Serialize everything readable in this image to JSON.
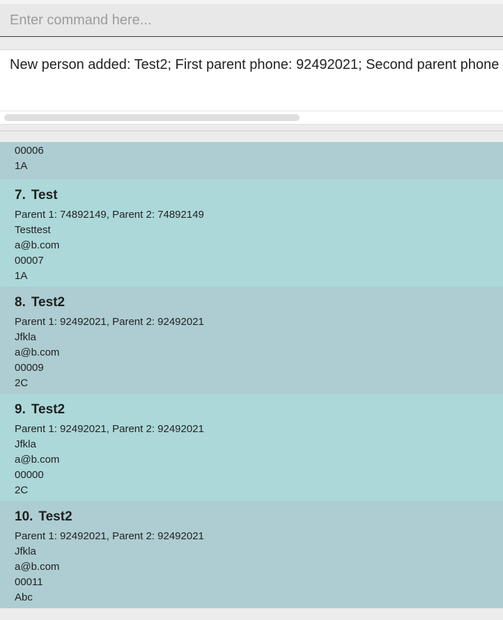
{
  "command": {
    "placeholder": "Enter command here..."
  },
  "result": {
    "text": "New person added: Test2; First parent phone: 92492021; Second parent phone"
  },
  "list": {
    "partial_card": {
      "lines": [
        "00006",
        "1A"
      ]
    },
    "cards": [
      {
        "index": "7.",
        "name": "Test",
        "phones": "Parent 1: 74892149, Parent 2: 74892149",
        "address": "Testtest",
        "email": "a@b.com",
        "id": "00007",
        "class": "1A"
      },
      {
        "index": "8.",
        "name": "Test2",
        "phones": "Parent 1: 92492021, Parent 2: 92492021",
        "address": "Jfkla",
        "email": "a@b.com",
        "id": "00009",
        "class": "2C"
      },
      {
        "index": "9.",
        "name": "Test2",
        "phones": "Parent 1: 92492021, Parent 2: 92492021",
        "address": "Jfkla",
        "email": "a@b.com",
        "id": "00000",
        "class": "2C"
      },
      {
        "index": "10.",
        "name": "Test2",
        "phones": "Parent 1: 92492021, Parent 2: 92492021",
        "address": "Jfkla",
        "email": "a@b.com",
        "id": "00011",
        "class": "Abc"
      }
    ]
  }
}
